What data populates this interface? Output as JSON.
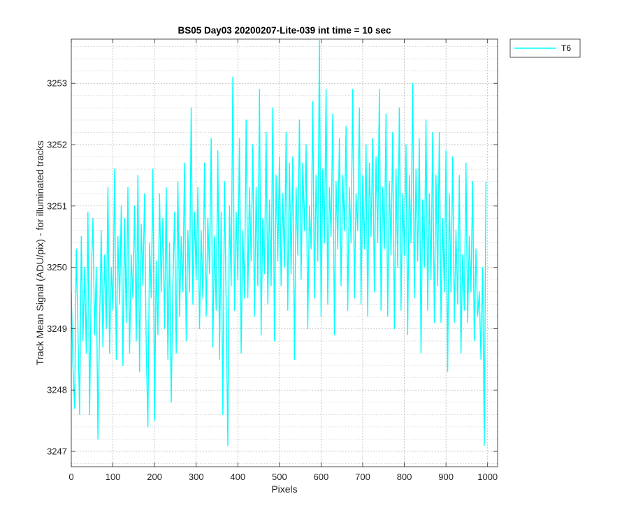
{
  "chart_data": {
    "type": "line",
    "title": "BS05 Day03 20200207-Lite-039 int time = 10 sec",
    "xlabel": "Pixels",
    "ylabel": "Track Mean Signal (ADU/pix) - for illuminated tracks",
    "xlim": [
      0,
      1024
    ],
    "ylim": [
      3246.75,
      3253.72
    ],
    "x_ticks": [
      0,
      100,
      200,
      300,
      400,
      500,
      600,
      700,
      800,
      900,
      1000
    ],
    "y_ticks": [
      3247,
      3248,
      3249,
      3250,
      3251,
      3252,
      3253
    ],
    "y_minor_step": 0.2,
    "grid": true,
    "minor_grid": true,
    "legend_position": "outside-top-right",
    "series": [
      {
        "name": "T6",
        "color": "#00FFFF",
        "x_start": 0,
        "x_step": 4,
        "values": [
          3249.6,
          3248.4,
          3247.7,
          3250.3,
          3249.0,
          3247.6,
          3250.5,
          3248.8,
          3250.0,
          3248.6,
          3250.9,
          3247.6,
          3249.8,
          3250.8,
          3248.9,
          3250.0,
          3247.2,
          3249.1,
          3250.6,
          3248.7,
          3250.2,
          3249.0,
          3251.3,
          3248.6,
          3250.0,
          3249.3,
          3251.6,
          3248.5,
          3250.5,
          3249.4,
          3251.0,
          3248.4,
          3250.8,
          3249.1,
          3251.3,
          3248.6,
          3250.2,
          3249.5,
          3251.0,
          3248.8,
          3251.5,
          3248.3,
          3250.7,
          3249.7,
          3251.2,
          3248.7,
          3247.4,
          3250.4,
          3249.5,
          3251.6,
          3247.5,
          3250.1,
          3248.9,
          3251.2,
          3249.6,
          3250.8,
          3249.0,
          3251.3,
          3248.5,
          3250.4,
          3247.8,
          3249.7,
          3250.9,
          3248.6,
          3251.4,
          3249.2,
          3250.5,
          3249.6,
          3251.7,
          3248.8,
          3250.6,
          3249.6,
          3252.6,
          3249.4,
          3250.9,
          3249.8,
          3251.3,
          3249.0,
          3250.6,
          3249.5,
          3251.7,
          3249.2,
          3250.8,
          3249.9,
          3252.1,
          3248.7,
          3250.5,
          3249.3,
          3251.9,
          3248.5,
          3250.9,
          3247.6,
          3251.4,
          3249.4,
          3247.1,
          3251.0,
          3249.7,
          3253.1,
          3249.3,
          3250.9,
          3249.8,
          3252.1,
          3248.6,
          3250.6,
          3249.5,
          3252.4,
          3249.5,
          3251.3,
          3250.1,
          3252.0,
          3249.2,
          3251.3,
          3249.7,
          3252.9,
          3248.9,
          3250.8,
          3249.9,
          3252.2,
          3249.4,
          3251.1,
          3249.7,
          3252.6,
          3248.8,
          3251.5,
          3250.1,
          3251.8,
          3249.7,
          3251.2,
          3250.0,
          3252.2,
          3249.3,
          3251.7,
          3249.9,
          3251.8,
          3248.5,
          3251.3,
          3250.2,
          3252.4,
          3249.8,
          3251.7,
          3250.6,
          3252.0,
          3249.0,
          3251.0,
          3250.3,
          3252.7,
          3249.5,
          3251.5,
          3250.1,
          3253.7,
          3249.2,
          3251.6,
          3250.4,
          3252.9,
          3249.4,
          3251.3,
          3250.5,
          3252.5,
          3248.9,
          3251.4,
          3250.3,
          3252.1,
          3249.7,
          3251.5,
          3250.6,
          3252.3,
          3249.3,
          3251.3,
          3250.4,
          3252.9,
          3249.5,
          3251.2,
          3250.6,
          3252.6,
          3249.4,
          3251.5,
          3250.3,
          3252.0,
          3249.2,
          3251.7,
          3250.5,
          3252.1,
          3249.6,
          3251.8,
          3250.4,
          3252.9,
          3249.3,
          3251.3,
          3250.3,
          3252.5,
          3249.2,
          3251.4,
          3250.2,
          3252.2,
          3249.0,
          3251.6,
          3250.0,
          3252.6,
          3249.3,
          3251.2,
          3250.2,
          3252.0,
          3248.9,
          3251.5,
          3250.4,
          3253.0,
          3249.5,
          3251.6,
          3250.1,
          3252.1,
          3248.6,
          3251.1,
          3250.0,
          3252.4,
          3249.3,
          3251.2,
          3249.8,
          3252.2,
          3249.1,
          3251.5,
          3249.7,
          3252.2,
          3249.1,
          3250.8,
          3249.6,
          3251.9,
          3248.3,
          3251.2,
          3249.6,
          3251.8,
          3249.1,
          3250.6,
          3249.4,
          3251.5,
          3248.6,
          3250.2,
          3249.3,
          3251.7,
          3249.1,
          3250.5,
          3249.6,
          3251.4,
          3248.8,
          3250.3,
          3249.2,
          3249.6,
          3248.5,
          3250.0,
          3247.1,
          3251.4
        ]
      }
    ]
  }
}
